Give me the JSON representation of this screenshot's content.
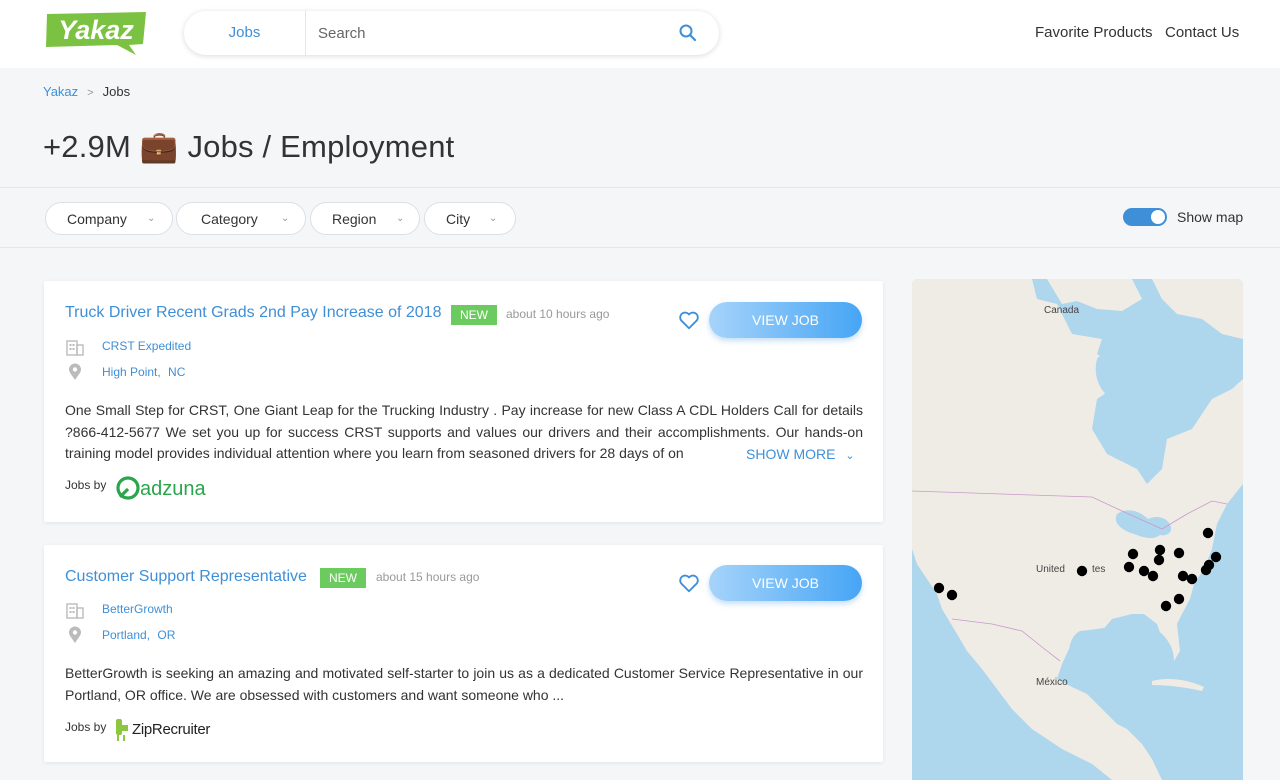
{
  "header": {
    "logo_text": "Yakaz",
    "search": {
      "category": "Jobs",
      "placeholder": "Search"
    },
    "nav": [
      "Favorite Products",
      "Contact Us"
    ]
  },
  "breadcrumb": {
    "root": "Yakaz",
    "current": "Jobs"
  },
  "page_title": "+2.9M 💼 Jobs / Employment",
  "filters": [
    "Company",
    "Category",
    "Region",
    "City"
  ],
  "show_map": {
    "label": "Show map",
    "enabled": true
  },
  "jobs": [
    {
      "title": "Truck Driver Recent Grads 2nd Pay Increase of 2018",
      "badge": "NEW",
      "time": "about 10 hours ago",
      "company": "CRST Expedited",
      "city": "High Point,",
      "state": "NC",
      "description": "One Small Step for CRST, One Giant Leap for the Trucking Industry . Pay increase for new Class A CDL Holders Call for details ?866-412-5677 We set you up for success CRST supports and values our drivers and their accomplishments. Our hands-on training model provides individual attention where you learn from seasoned drivers for 28 days of on",
      "show_more": "SHOW MORE",
      "view_label": "VIEW JOB",
      "jobs_by": "Jobs by",
      "provider": "adzuna"
    },
    {
      "title": "Customer Support Representative",
      "badge": "NEW",
      "time": "about 15 hours ago",
      "company": "BetterGrowth",
      "city": "Portland,",
      "state": "OR",
      "description": "BetterGrowth is seeking an amazing and motivated self-starter to join us as a dedicated Customer Service Representative in our Portland, OR office. We are obsessed with customers and want someone who ...",
      "view_label": "VIEW JOB",
      "jobs_by": "Jobs by",
      "provider": "ZipRecruiter"
    }
  ],
  "map": {
    "labels": {
      "canada": "Canada",
      "us_left": "United",
      "us_right": "tes",
      "mexico": "México"
    }
  },
  "colors": {
    "accent": "#3f8fd8",
    "badge": "#6ccb5f",
    "logo": "#7cc242",
    "adzuna": "#2aa54b",
    "ziprecruiter": "#8dc63f"
  },
  "icons": [
    "search-icon",
    "chevron-down-icon",
    "heart-icon",
    "building-icon",
    "location-pin-icon"
  ]
}
